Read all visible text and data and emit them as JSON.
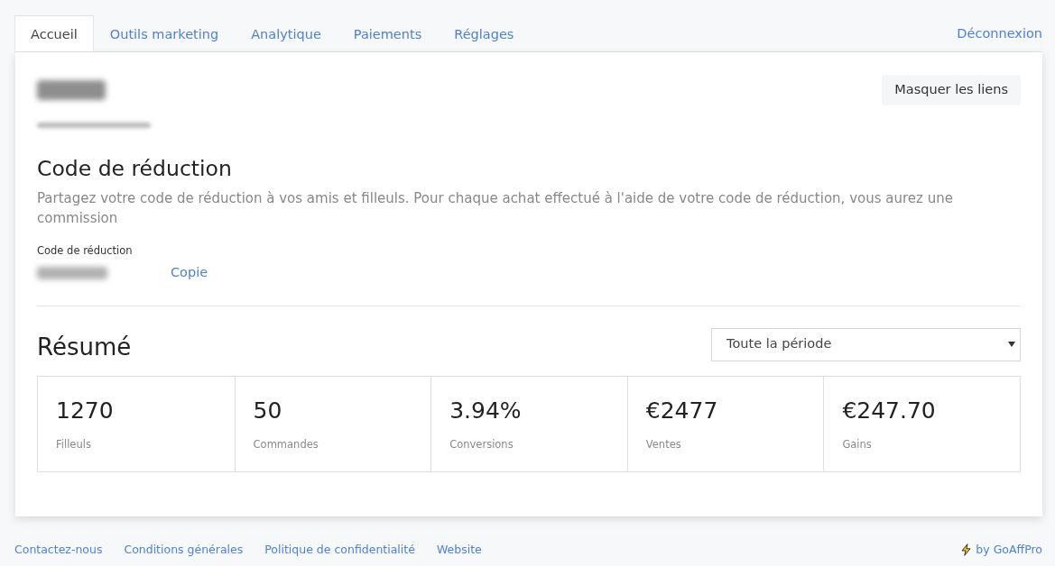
{
  "tabs": [
    {
      "label": "Accueil",
      "selected": true
    },
    {
      "label": "Outils marketing",
      "selected": false
    },
    {
      "label": "Analytique",
      "selected": false
    },
    {
      "label": "Paiements",
      "selected": false
    },
    {
      "label": "Réglages",
      "selected": false
    }
  ],
  "logout_link": "Déconnexion",
  "hide_links_button": "Masquer les liens",
  "discount_section": {
    "title": "Code de réduction",
    "description": "Partagez votre code de réduction à vos amis et filleuls. Pour chaque achat effectué à l'aide de votre code de réduction, vous aurez une commission",
    "field_label": "Code de réduction",
    "copy_link": "Copie"
  },
  "summary": {
    "title": "Résumé",
    "period_select": {
      "value": "Toute la période"
    },
    "stats": [
      {
        "value": "1270",
        "label": "Filleuls"
      },
      {
        "value": "50",
        "label": "Commandes"
      },
      {
        "value": "3.94%",
        "label": "Conversions"
      },
      {
        "value": "€2477",
        "label": "Ventes"
      },
      {
        "value": "€247.70",
        "label": "Gains"
      }
    ]
  },
  "footer": {
    "links": [
      "Contactez-nous",
      "Conditions générales",
      "Politique de confidentialité",
      "Website"
    ],
    "credit": "by GoAffPro"
  }
}
